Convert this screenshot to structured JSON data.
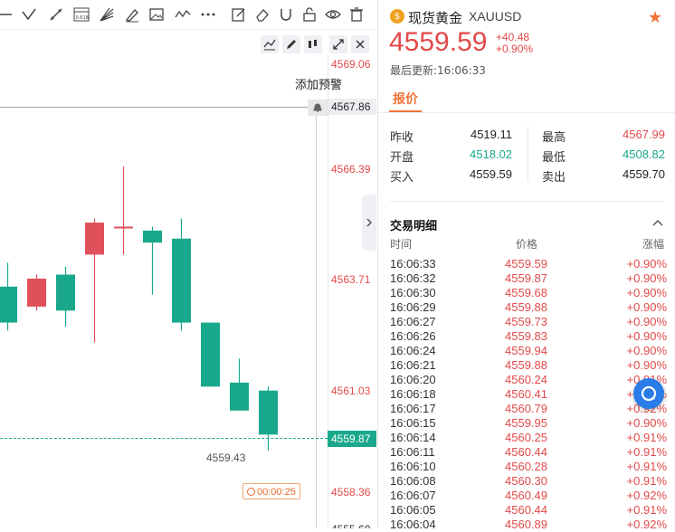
{
  "chart": {
    "price_ticks": [
      "4569.06",
      "4566.39",
      "4563.71",
      "4561.03",
      "4558.36"
    ],
    "add_alert_label": "添加预警",
    "alert_price": "4567.86",
    "current_price": "4559.87",
    "low_label": "4559.43",
    "countdown": "00:00:25",
    "bottom_cut_label": "4555.60",
    "up_color": "#1aa88d",
    "down_color": "#e0505a"
  },
  "instrument": {
    "name": "现货黄金",
    "symbol": "XAUUSD",
    "price": "4559.59",
    "change": "+40.48",
    "change_pct": "+0.90%",
    "updated_label": "最后更新:",
    "updated_time": "16:06:33",
    "tab": "报价"
  },
  "quote": {
    "prev_close_label": "昨收",
    "prev_close": "4519.11",
    "high_label": "最高",
    "high": "4567.99",
    "open_label": "开盘",
    "open": "4518.02",
    "low_label": "最低",
    "low": "4508.82",
    "bid_label": "买入",
    "bid": "4559.59",
    "ask_label": "卖出",
    "ask": "4559.70"
  },
  "trades": {
    "title": "交易明细",
    "col_time": "时间",
    "col_price": "价格",
    "col_change": "涨幅",
    "rows": [
      {
        "time": "16:06:33",
        "price": "4559.59",
        "chg": "+0.90%"
      },
      {
        "time": "16:06:32",
        "price": "4559.87",
        "chg": "+0.90%"
      },
      {
        "time": "16:06:30",
        "price": "4559.68",
        "chg": "+0.90%"
      },
      {
        "time": "16:06:29",
        "price": "4559.88",
        "chg": "+0.90%"
      },
      {
        "time": "16:06:27",
        "price": "4559.73",
        "chg": "+0.90%"
      },
      {
        "time": "16:06:26",
        "price": "4559.83",
        "chg": "+0.90%"
      },
      {
        "time": "16:06:24",
        "price": "4559.94",
        "chg": "+0.90%"
      },
      {
        "time": "16:06:21",
        "price": "4559.88",
        "chg": "+0.90%"
      },
      {
        "time": "16:06:20",
        "price": "4560.24",
        "chg": "+0.91%"
      },
      {
        "time": "16:06:18",
        "price": "4560.41",
        "chg": "+0.91%"
      },
      {
        "time": "16:06:17",
        "price": "4560.79",
        "chg": "+0.92%"
      },
      {
        "time": "16:06:15",
        "price": "4559.95",
        "chg": "+0.90%"
      },
      {
        "time": "16:06:14",
        "price": "4560.25",
        "chg": "+0.91%"
      },
      {
        "time": "16:06:11",
        "price": "4560.44",
        "chg": "+0.91%"
      },
      {
        "time": "16:06:10",
        "price": "4560.28",
        "chg": "+0.91%"
      },
      {
        "time": "16:06:08",
        "price": "4560.30",
        "chg": "+0.91%"
      },
      {
        "time": "16:06:07",
        "price": "4560.49",
        "chg": "+0.92%"
      },
      {
        "time": "16:06:05",
        "price": "4560.44",
        "chg": "+0.91%"
      },
      {
        "time": "16:06:04",
        "price": "4560.89",
        "chg": "+0.92%"
      }
    ]
  },
  "candles": [
    {
      "o": 4563.5,
      "c": 4562.6,
      "h": 4564.1,
      "l": 4562.4
    },
    {
      "o": 4563.0,
      "c": 4563.7,
      "h": 4563.8,
      "l": 4562.9
    },
    {
      "o": 4563.8,
      "c": 4562.9,
      "h": 4564.0,
      "l": 4562.5
    },
    {
      "o": 4564.3,
      "c": 4565.1,
      "h": 4565.2,
      "l": 4562.1
    },
    {
      "o": 4565.0,
      "c": 4565.0,
      "h": 4566.5,
      "l": 4564.3
    },
    {
      "o": 4564.9,
      "c": 4564.6,
      "h": 4565.0,
      "l": 4563.3
    },
    {
      "o": 4564.7,
      "c": 4562.6,
      "h": 4565.2,
      "l": 4562.4
    },
    {
      "o": 4562.6,
      "c": 4561.0,
      "h": 4562.6,
      "l": 4561.0
    },
    {
      "o": 4561.1,
      "c": 4560.4,
      "h": 4561.7,
      "l": 4560.4
    },
    {
      "o": 4560.9,
      "c": 4559.8,
      "h": 4561.0,
      "l": 4559.4
    }
  ]
}
